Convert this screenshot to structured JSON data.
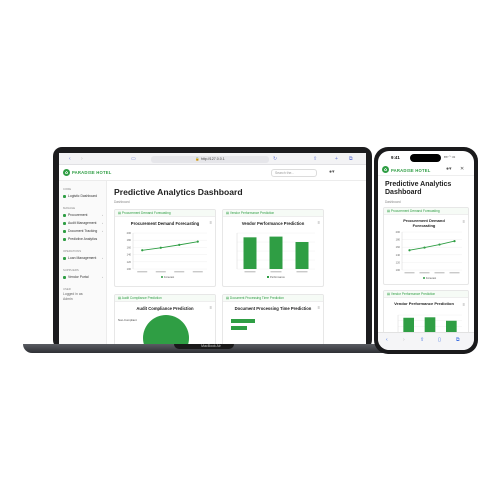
{
  "laptop": {
    "device_label": "MacBook Air",
    "url": "http://127.0.0.1",
    "header": {
      "brand": "PARADISE HOTEL",
      "search_placeholder": "Search the..."
    },
    "sidebar": {
      "groups": [
        {
          "label": "CORE",
          "items": [
            {
              "label": "Logistic Dashboard",
              "chevron": false
            }
          ]
        },
        {
          "label": "MANAGE",
          "items": [
            {
              "label": "Procurement",
              "chevron": true
            },
            {
              "label": "Audit Management",
              "chevron": true
            },
            {
              "label": "Document Tracking",
              "chevron": true
            },
            {
              "label": "Predictive Analytics",
              "chevron": false
            }
          ]
        },
        {
          "label": "OPERATIONS",
          "items": [
            {
              "label": "Loan Management",
              "chevron": true
            }
          ]
        },
        {
          "label": "SUPPLIERS",
          "items": [
            {
              "label": "Vendor Portal",
              "chevron": true
            }
          ]
        },
        {
          "label": "USER",
          "items": [
            {
              "label": "Logged in as:",
              "chevron": false
            },
            {
              "label": "Admin",
              "chevron": false
            }
          ]
        }
      ]
    },
    "main": {
      "page_title": "Predictive Analytics Dashboard",
      "breadcrumb": "Dashboard",
      "cards": {
        "procurement": {
          "header": "Procurement Demand Forecasting",
          "title": "Procurement Demand Forecasting",
          "legend": "Forecast"
        },
        "vendor": {
          "header": "Vendor Performance Prediction",
          "title": "Vendor Performance Prediction",
          "legend": "Performance"
        },
        "audit": {
          "header": "Audit Compliance Prediction",
          "title": "Audit Compliance Prediction",
          "side_label": "Non-Compliant"
        },
        "document": {
          "header": "Document Processing Time Prediction",
          "title": "Document Processing Time Prediction"
        }
      }
    }
  },
  "phone": {
    "time": "9:41",
    "status_icons": "▪▪▪ ◠ ▭",
    "brand": "PARADISE HOTEL",
    "page_title": "Predictive Analytics Dashboard",
    "breadcrumb": "Dashboard",
    "card1_header": "Procurement Demand Forecasting",
    "card1_title": "Procurement Demand Forecasting",
    "card1_legend": "Forecast",
    "card2_header": "Vendor Performance Prediction",
    "card2_title": "Vendor Performance Prediction",
    "url": "127.0.0.1"
  },
  "colors": {
    "accent": "#2f9e44",
    "device": "#1c1c1e",
    "browser_icons": "#3c6de0"
  },
  "icons": [
    "back-icon",
    "forward-icon",
    "sidebar-toggle-icon",
    "lock-icon",
    "reload-icon",
    "share-icon",
    "new-tab-icon",
    "tabs-icon",
    "user-icon",
    "menu-icon"
  ],
  "chart_data": [
    {
      "type": "line",
      "title": "Procurement Demand Forecasting",
      "categories": [
        "",
        "",
        "",
        ""
      ],
      "series": [
        {
          "name": "Forecast",
          "values": [
            152,
            159,
            167,
            176
          ]
        }
      ],
      "ylim": [
        100,
        200
      ],
      "ticks": [
        "200",
        "180",
        "160",
        "140",
        "120",
        "100"
      ],
      "grid": true,
      "legend": "bottom"
    },
    {
      "type": "bar",
      "title": "Vendor Performance Prediction",
      "categories": [
        "",
        "",
        ""
      ],
      "series": [
        {
          "name": "Performance",
          "values": [
            88,
            90,
            75
          ]
        }
      ],
      "ylim": [
        0,
        100
      ],
      "grid": true,
      "legend": "bottom"
    },
    {
      "type": "pie",
      "title": "Audit Compliance Prediction",
      "labels": [
        "Non-Compliant"
      ]
    },
    {
      "type": "bar",
      "title": "Document Processing Time Prediction",
      "orientation": "horizontal"
    }
  ]
}
